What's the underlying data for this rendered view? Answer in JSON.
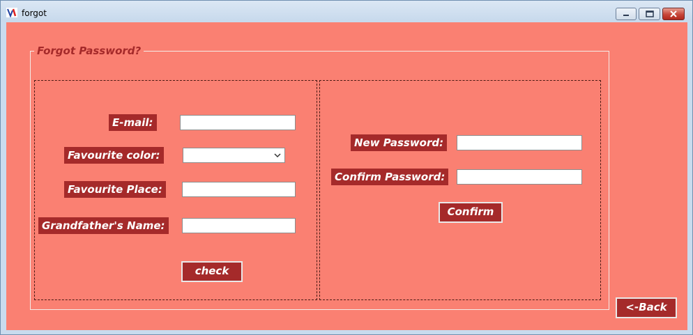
{
  "window": {
    "title": "forgot",
    "icons": {
      "app": "app-icon",
      "minimize": "minimize-icon",
      "maximize": "maximize-icon",
      "close": "close-icon"
    }
  },
  "form": {
    "group_title": "Forgot Password?",
    "verification": {
      "email_label": "E-mail:",
      "email_value": "",
      "color_label": "Favourite color:",
      "color_selected": "",
      "place_label": "Favourite Place:",
      "place_value": "",
      "grandfather_label": "Grandfather's Name:",
      "grandfather_value": "",
      "check_label": "check"
    },
    "reset": {
      "new_password_label": "New Password:",
      "new_password_value": "",
      "confirm_password_label": "Confirm Password:",
      "confirm_password_value": "",
      "confirm_label": "Confirm"
    },
    "back_label": "<-Back"
  },
  "colors": {
    "background": "#fa8072",
    "label_bg": "#a52a2a",
    "title_color": "#a52a2a"
  }
}
